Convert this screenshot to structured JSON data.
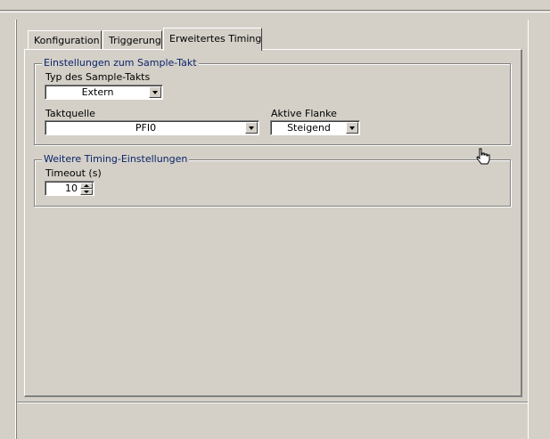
{
  "tabs": {
    "konfiguration": "Konfiguration",
    "triggerung": "Triggerung",
    "erweitertes_timing": "Erweitertes Timing",
    "active": "erweitertes_timing"
  },
  "sample_clock": {
    "group_title": "Einstellungen zum Sample-Takt",
    "type_label": "Typ des Sample-Takts",
    "type_value": "Extern",
    "source_label": "Taktquelle",
    "source_value": "PFI0",
    "edge_label": "Aktive Flanke",
    "edge_value": "Steigend"
  },
  "timing": {
    "group_title": "Weitere Timing-Einstellungen",
    "timeout_label": "Timeout (s)",
    "timeout_value": "10"
  },
  "icons": {
    "cursor": "hand-pointer-icon",
    "dropdown": "chevron-down-icon",
    "spin_up": "spin-up-icon",
    "spin_down": "spin-down-icon"
  },
  "colors": {
    "face": "#d4d0c8",
    "group_title": "#0a246a",
    "shadow": "#808080",
    "highlight": "#ffffff"
  }
}
